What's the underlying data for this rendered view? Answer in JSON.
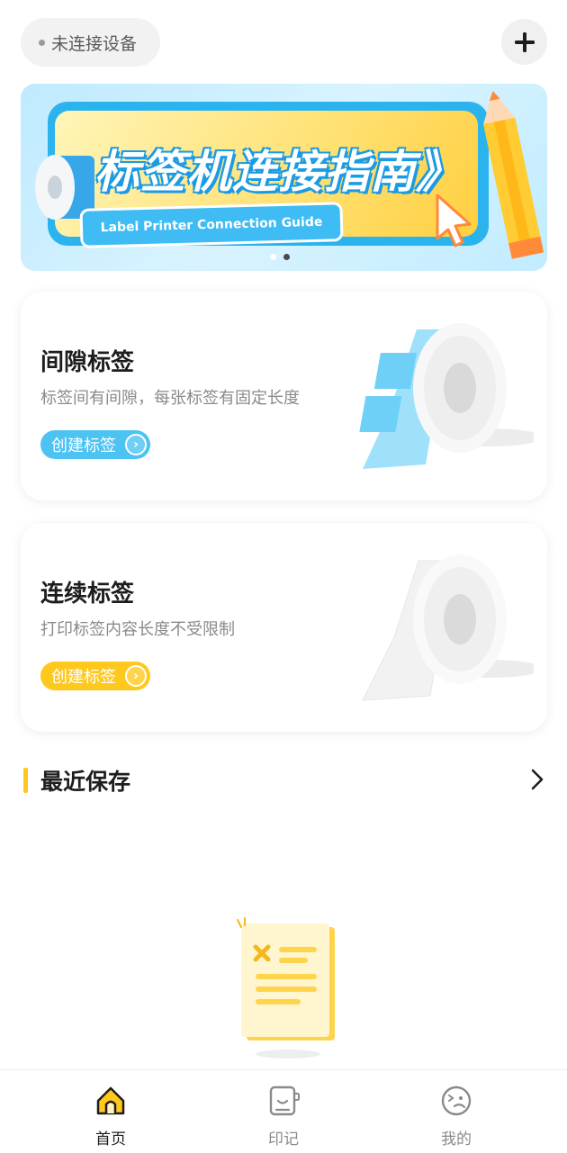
{
  "device": {
    "status": "未连接设备"
  },
  "banner": {
    "title": "标签机连接指南》",
    "subtitle": "Label Printer Connection Guide"
  },
  "cards": [
    {
      "title": "间隙标签",
      "description": "标签间有间隙，每张标签有固定长度",
      "button": "创建标签",
      "accent": "#4cc3f2"
    },
    {
      "title": "连续标签",
      "description": "打印标签内容长度不受限制",
      "button": "创建标签",
      "accent": "#ffc81d"
    }
  ],
  "recent": {
    "title": "最近保存"
  },
  "tabs": [
    {
      "label": "首页",
      "icon": "home-icon",
      "active": true
    },
    {
      "label": "印记",
      "icon": "notebook-icon",
      "active": false
    },
    {
      "label": "我的",
      "icon": "profile-face-icon",
      "active": false
    }
  ],
  "colors": {
    "accent_yellow": "#ffc81d",
    "accent_blue": "#4cc3f2"
  }
}
